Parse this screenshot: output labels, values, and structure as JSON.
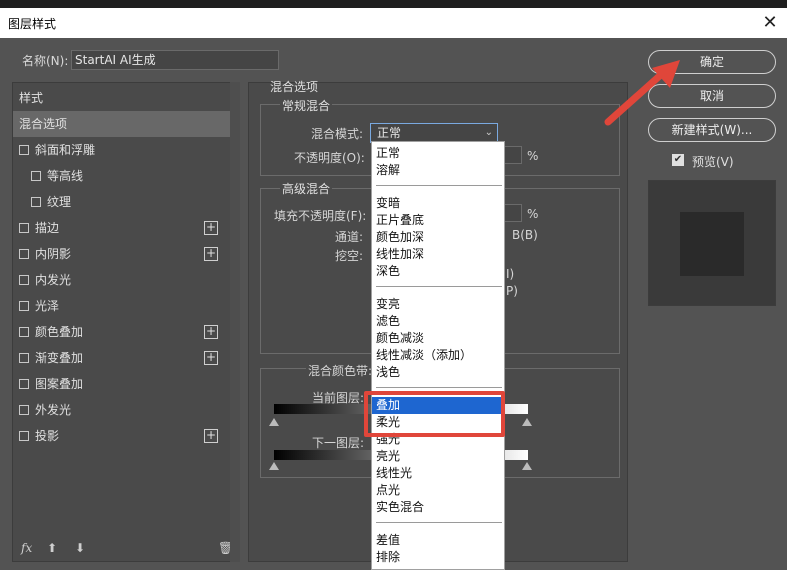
{
  "window": {
    "title": "图层样式"
  },
  "name_field": {
    "label": "名称(N):",
    "value": "StartAI AI生成"
  },
  "left_panel": {
    "header": "样式",
    "items": [
      {
        "label": "混合选项",
        "checkbox": false,
        "plus": false,
        "selected": true
      },
      {
        "label": "斜面和浮雕",
        "checkbox": true,
        "plus": false
      },
      {
        "label": "等高线",
        "checkbox": true,
        "plus": false,
        "indent": true
      },
      {
        "label": "纹理",
        "checkbox": true,
        "plus": false,
        "indent": true
      },
      {
        "label": "描边",
        "checkbox": true,
        "plus": true
      },
      {
        "label": "内阴影",
        "checkbox": true,
        "plus": true
      },
      {
        "label": "内发光",
        "checkbox": true,
        "plus": false
      },
      {
        "label": "光泽",
        "checkbox": true,
        "plus": false
      },
      {
        "label": "颜色叠加",
        "checkbox": true,
        "plus": true
      },
      {
        "label": "渐变叠加",
        "checkbox": true,
        "plus": true
      },
      {
        "label": "图案叠加",
        "checkbox": true,
        "plus": false
      },
      {
        "label": "外发光",
        "checkbox": true,
        "plus": false
      },
      {
        "label": "投影",
        "checkbox": true,
        "plus": true
      }
    ],
    "footer": {
      "fx": "fx",
      "icons": [
        "up-arrow-icon",
        "down-arrow-icon",
        "trash-icon"
      ]
    }
  },
  "center": {
    "section_title": "混合选项",
    "general": {
      "title": "常规混合",
      "blend_mode_label": "混合模式:",
      "blend_mode_value": "正常",
      "opacity_label": "不透明度(O):",
      "opacity_unit": "%"
    },
    "advanced": {
      "title": "高级混合",
      "fill_opacity_label": "填充不透明度(F):",
      "fill_opacity_unit": "%",
      "channels_label": "通道:",
      "channel_b": "B(B)",
      "knockout_label": "挖空:",
      "frag_i": "I)",
      "frag_p": "P)"
    },
    "blend_if": {
      "title": "混合颜色带:",
      "this_layer": "当前图层:",
      "underlying_layer": "下一图层:"
    }
  },
  "dropdown": {
    "groups": [
      [
        "正常",
        "溶解"
      ],
      [
        "变暗",
        "正片叠底",
        "颜色加深",
        "线性加深",
        "深色"
      ],
      [
        "变亮",
        "滤色",
        "颜色减淡",
        "线性减淡（添加）",
        "浅色"
      ],
      [
        "叠加",
        "柔光",
        "强光",
        "亮光",
        "线性光",
        "点光",
        "实色混合"
      ],
      [
        "差值",
        "排除"
      ]
    ],
    "highlighted": "叠加"
  },
  "buttons": {
    "ok": "确定",
    "cancel": "取消",
    "new_style": "新建样式(W)..."
  },
  "preview": {
    "label": "预览(V)",
    "checked": true
  },
  "colors": {
    "annotation": "#e0463a",
    "highlight": "#1e66d0",
    "panel": "#535353"
  }
}
